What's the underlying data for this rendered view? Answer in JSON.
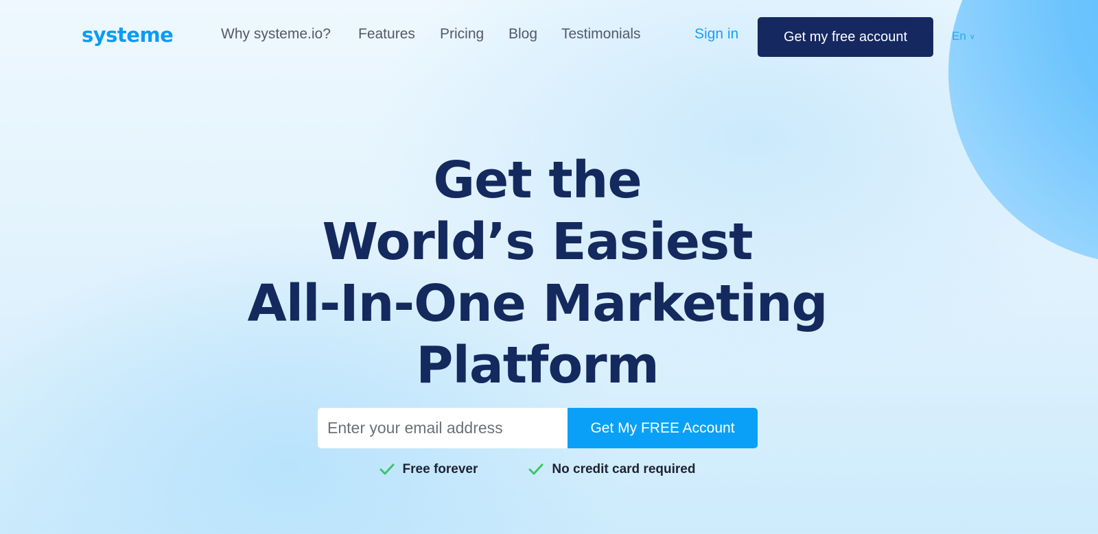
{
  "brand": {
    "logo_text": "systeme",
    "color": "#0a9cf5"
  },
  "nav": {
    "links": [
      "Why systeme.io?",
      "Features",
      "Pricing",
      "Blog",
      "Testimonials"
    ],
    "sign_in": "Sign in",
    "cta": "Get my free account",
    "language": "En"
  },
  "hero": {
    "title_lines": [
      "Get the",
      "World’s Easiest",
      "All-In-One Marketing",
      "Platform"
    ],
    "color": "#14295d"
  },
  "signup": {
    "email_placeholder": "Enter your email address",
    "email_value": "",
    "submit_label": "Get My FREE Account",
    "accent": "#0aa0f7"
  },
  "perks": [
    {
      "icon": "check-icon",
      "label": "Free forever"
    },
    {
      "icon": "check-icon",
      "label": "No credit card required"
    }
  ],
  "colors": {
    "check": "#3cc46a",
    "cta_dark": "#152860"
  }
}
